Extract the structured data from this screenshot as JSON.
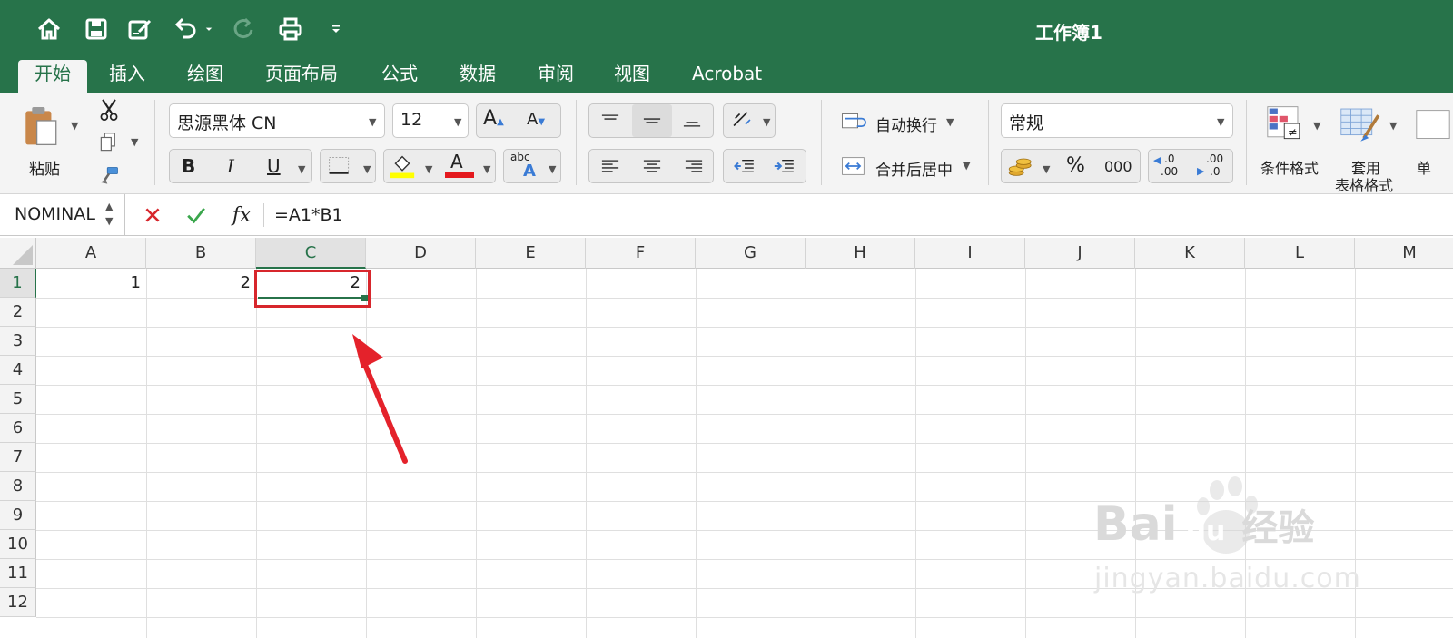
{
  "window": {
    "title": "工作簿1"
  },
  "quick_access": [
    "home-icon",
    "save-icon",
    "edit-icon",
    "undo-icon",
    "redo-icon",
    "print-icon",
    "customize-icon"
  ],
  "tabs": [
    {
      "label": "开始",
      "active": true
    },
    {
      "label": "插入"
    },
    {
      "label": "绘图"
    },
    {
      "label": "页面布局"
    },
    {
      "label": "公式"
    },
    {
      "label": "数据"
    },
    {
      "label": "审阅"
    },
    {
      "label": "视图"
    },
    {
      "label": "Acrobat"
    }
  ],
  "ribbon": {
    "paste_label": "粘贴",
    "font_name": "思源黑体 CN",
    "font_size": "12",
    "grow_font": "A",
    "shrink_font": "A",
    "bold": "B",
    "italic": "I",
    "underline": "U",
    "font_color": "A",
    "phonetic_abc": "abc",
    "phonetic_a": "A",
    "wrap_text": "自动换行",
    "merge_center": "合并后居中",
    "number_format": "常规",
    "percent": "%",
    "comma": "000",
    "inc_decimal_a": ".0",
    "inc_decimal_b": ".00",
    "dec_decimal_a": ".00",
    "dec_decimal_b": ".0",
    "conditional_format": "条件格式",
    "table_format_1": "套用",
    "table_format_2": "表格格式",
    "cell_style_partial": "单",
    "colors": {
      "fill_yellow": "#ffff00",
      "font_red": "#e4191e",
      "brand_green": "#27734a"
    }
  },
  "formula_bar": {
    "name_box": "NOMINAL",
    "fx": "fx",
    "formula": "=A1*B1"
  },
  "sheet": {
    "columns": [
      "A",
      "B",
      "C",
      "D",
      "E",
      "F",
      "G",
      "H",
      "I",
      "J",
      "K",
      "L",
      "M"
    ],
    "rows": [
      "1",
      "2",
      "3",
      "4",
      "5",
      "6",
      "7",
      "8",
      "9",
      "10",
      "11",
      "12"
    ],
    "selected_column": "C",
    "selected_row": "1",
    "cells": {
      "A1": "1",
      "B1": "2",
      "C1": "2"
    }
  },
  "watermark": {
    "brand": "Bai",
    "brand2": "du",
    "brand3": "经验",
    "url": "jingyan.baidu.com"
  }
}
